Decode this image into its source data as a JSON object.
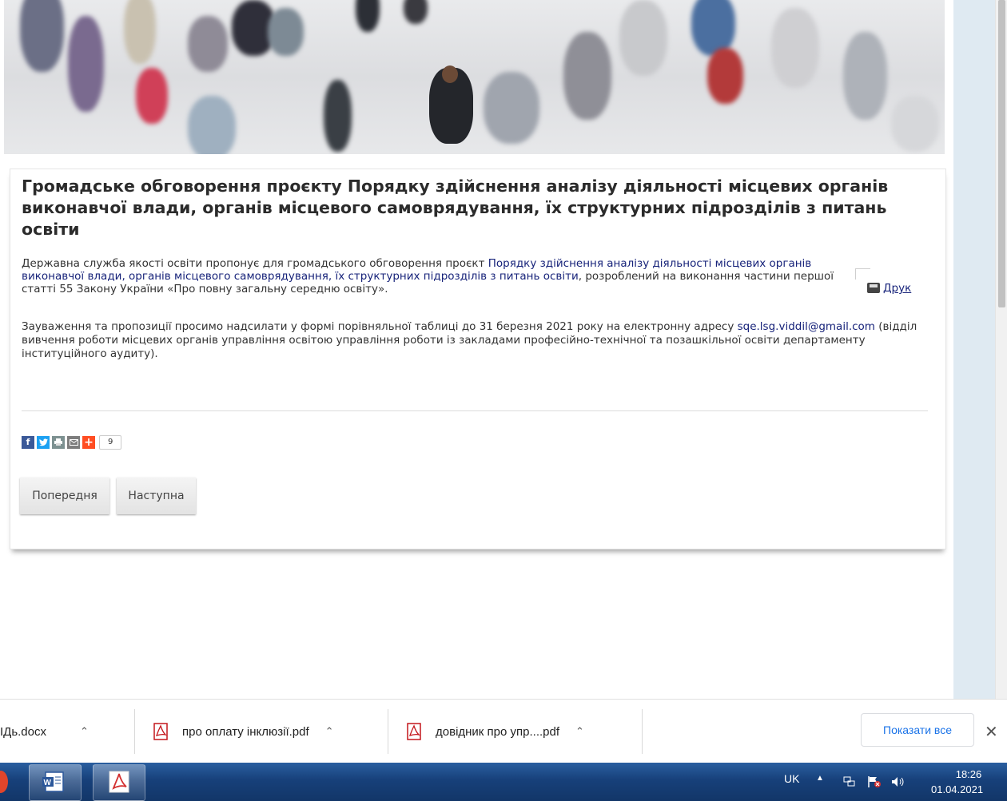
{
  "article": {
    "title": "Громадське обговорення проєкту Порядку здійснення аналізу діяльності місцевих органів виконавчої влади, органів місцевого самоврядування, їх структурних підрозділів з питань освіти",
    "p1_text_before": " Державна служба якості освіти  пропонує  для громадського обговорення проєкт ",
    "p1_link": "Порядку здійснення аналізу діяльності місцевих органів виконавчої влади, органів місцевого самоврядування, їх структурних підрозділів з питань освіти",
    "p1_text_after": ", розроблений на виконання частини першої статті 55 Закону України «Про повну загальну середню освіту».",
    "p2_text_before": "Зауваження та пропозиції просимо надсилати у формі порівняльної таблиці до 31 березня 2021 року на електронну адресу ",
    "p2_email": "sqe.lsg.viddil@gmail.com",
    "p2_text_after": " (відділ вивчення роботи місцевих органів управління освітою управління роботи із закладами професійно-технічної та позашкільної освіти департаменту інституційного аудиту).",
    "print_label": "Друк",
    "share_count": "9",
    "prev_label": "Попередня",
    "next_label": "Наступна"
  },
  "share_icons": [
    "facebook-icon",
    "twitter-icon",
    "print-icon",
    "email-icon",
    "plus-icon"
  ],
  "downloads": {
    "items": [
      {
        "name": "ІДь.docx"
      },
      {
        "name": "про оплату інклюзії.pdf"
      },
      {
        "name": "довідник про упр....pdf"
      }
    ],
    "show_all": "Показати все"
  },
  "taskbar": {
    "lang": "UK",
    "time": "18:26",
    "date": "01.04.2021"
  },
  "colors": {
    "link": "#17237a",
    "show_all": "#1a73e8",
    "taskbar": "#17407a"
  }
}
